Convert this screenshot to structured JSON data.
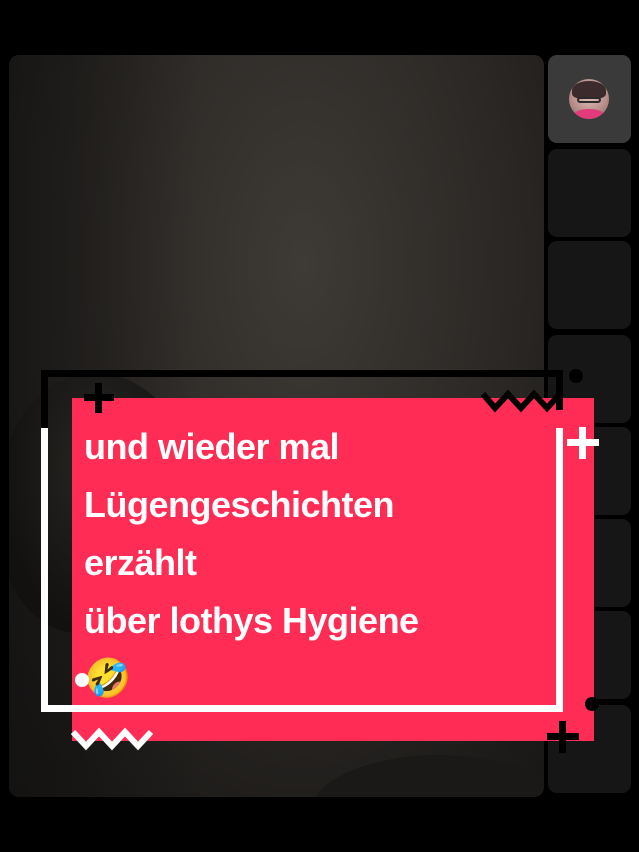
{
  "main_video": {
    "description_icon": "video-feed"
  },
  "participants": {
    "tiles": [
      {
        "active": true,
        "icon": "avatar"
      },
      {
        "active": false
      },
      {
        "active": false
      },
      {
        "active": false
      },
      {
        "active": false
      },
      {
        "active": false
      },
      {
        "active": false
      },
      {
        "active": false
      }
    ]
  },
  "caption": {
    "lines": [
      "und wieder mal",
      "Lügengeschichten",
      "erzählt",
      "über lothys Hygiene"
    ],
    "emoji": "🤣",
    "background_color": "#ff2d55",
    "text_color": "#ffffff"
  }
}
